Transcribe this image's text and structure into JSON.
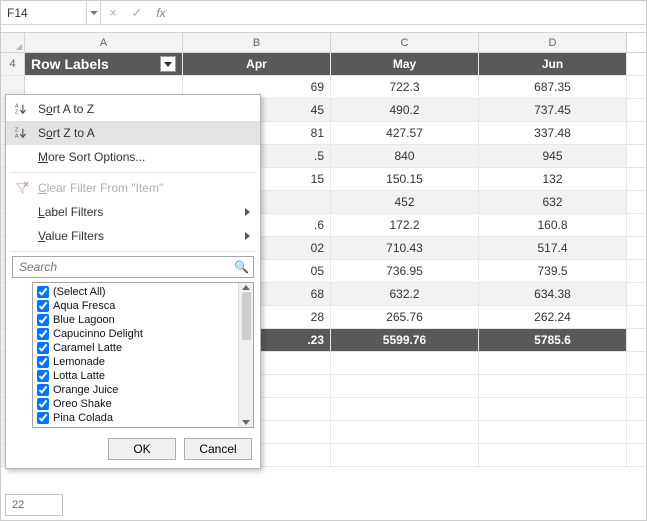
{
  "formula_bar": {
    "namebox": "F14",
    "cancel_glyph": "×",
    "confirm_glyph": "✓",
    "fx_label": "fx",
    "formula_value": ""
  },
  "columns": [
    "A",
    "B",
    "C",
    "D"
  ],
  "row_index_start": "4",
  "header_row": {
    "label": "Row Labels",
    "months": [
      "Apr",
      "May",
      "Jun"
    ]
  },
  "rows": [
    {
      "b": "69",
      "c": "722.3",
      "d": "687.35"
    },
    {
      "b": "45",
      "c": "490.2",
      "d": "737.45"
    },
    {
      "b": "81",
      "c": "427.57",
      "d": "337.48"
    },
    {
      "b": ".5",
      "c": "840",
      "d": "945"
    },
    {
      "b": "15",
      "c": "150.15",
      "d": "132"
    },
    {
      "b": "",
      "c": "452",
      "d": "632"
    },
    {
      "b": ".6",
      "c": "172.2",
      "d": "160.8"
    },
    {
      "b": "02",
      "c": "710.43",
      "d": "517.4"
    },
    {
      "b": "05",
      "c": "736.95",
      "d": "739.5"
    },
    {
      "b": "68",
      "c": "632.2",
      "d": "634.38"
    },
    {
      "b": "28",
      "c": "265.76",
      "d": "262.24"
    }
  ],
  "total_row": {
    "b": ".23",
    "c": "5599.76",
    "d": "5785.6"
  },
  "bottom_row_label": "22",
  "dropdown": {
    "sort_az_pre": "S",
    "sort_az_accel": "o",
    "sort_az_post": "rt A to Z",
    "sort_za_pre": "S",
    "sort_za_accel": "o",
    "sort_za_post": "rt Z to A",
    "more_sort_pre": "",
    "more_sort_accel": "M",
    "more_sort_post": "ore Sort Options...",
    "clear_filter_pre": "",
    "clear_filter_accel": "C",
    "clear_filter_post": "lear Filter From \"Item\"",
    "label_filters_pre": "",
    "label_filters_accel": "L",
    "label_filters_post": "abel Filters",
    "value_filters_pre": "",
    "value_filters_accel": "V",
    "value_filters_post": "alue Filters",
    "search_placeholder": "Search",
    "items": [
      "(Select All)",
      "Aqua Fresca",
      "Blue Lagoon",
      "Capucinno Delight",
      "Caramel Latte",
      "Lemonade",
      "Lotta Latte",
      "Orange Juice",
      "Oreo Shake",
      "Pina Colada"
    ],
    "ok_label": "OK",
    "cancel_label": "Cancel"
  }
}
